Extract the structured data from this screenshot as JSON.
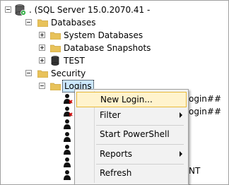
{
  "tree": {
    "server": {
      "label": ". (SQL Server 15.0.2070.41 -"
    },
    "databases": {
      "label": "Databases",
      "children": [
        {
          "label": "System Databases"
        },
        {
          "label": "Database Snapshots"
        },
        {
          "label": "TEST"
        }
      ]
    },
    "security": {
      "label": "Security",
      "logins": {
        "label": "Logins",
        "items": [
          {
            "suffix": "ogin##"
          },
          {
            "suffix": "ogin##"
          },
          {
            "suffix": ""
          },
          {
            "suffix": ""
          },
          {
            "suffix": ""
          },
          {
            "suffix": ""
          },
          {
            "suffix": "NT"
          }
        ]
      }
    }
  },
  "context_menu": {
    "items": [
      {
        "label": "New Login...",
        "submenu": false,
        "highlighted": true
      },
      {
        "label": "Filter",
        "submenu": true
      },
      {
        "label": "Start PowerShell",
        "submenu": false
      },
      {
        "label": "Reports",
        "submenu": true
      },
      {
        "label": "Refresh",
        "submenu": false
      }
    ]
  },
  "colors": {
    "folder": "#e8c25a",
    "selection": "#cce8ff",
    "menu_highlight": "#fff3cd",
    "menu_highlight_border": "#e8b93a",
    "disabled_x": "#cc0000"
  }
}
